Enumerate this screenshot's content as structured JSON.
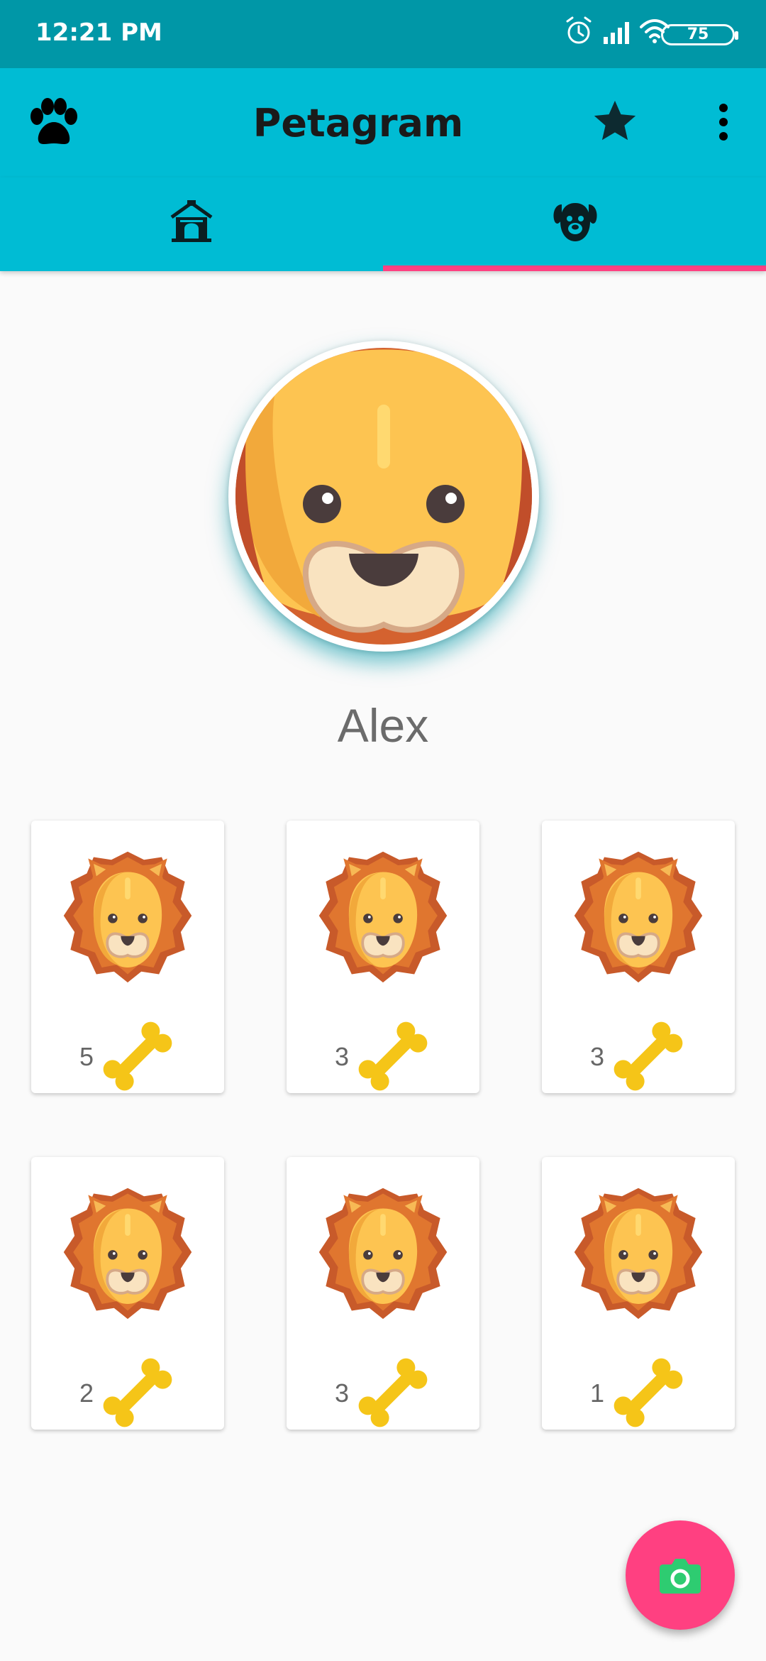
{
  "status_bar": {
    "time": "12:21 PM",
    "battery": "75",
    "icons": [
      "alarm-icon",
      "signal-icon",
      "wifi-icon",
      "battery-icon"
    ]
  },
  "app_bar": {
    "title": "Petagram",
    "left_icon": "paw-icon",
    "actions": [
      "star-icon",
      "more-vert-icon"
    ]
  },
  "tabs": [
    {
      "icon": "pet-house-icon",
      "selected": false
    },
    {
      "icon": "dog-face-icon",
      "selected": true
    }
  ],
  "profile": {
    "name": "Alex",
    "avatar": "lion-face"
  },
  "photos": [
    {
      "likes": "5",
      "image": "lion-icon"
    },
    {
      "likes": "3",
      "image": "lion-icon"
    },
    {
      "likes": "3",
      "image": "lion-icon"
    },
    {
      "likes": "2",
      "image": "lion-icon"
    },
    {
      "likes": "3",
      "image": "lion-icon"
    },
    {
      "likes": "1",
      "image": "lion-icon"
    }
  ],
  "fab": {
    "icon": "camera-icon"
  },
  "colors": {
    "status_bar": "#0097a7",
    "primary": "#00bcd4",
    "accent": "#ff4081",
    "bone": "#f5c518"
  }
}
